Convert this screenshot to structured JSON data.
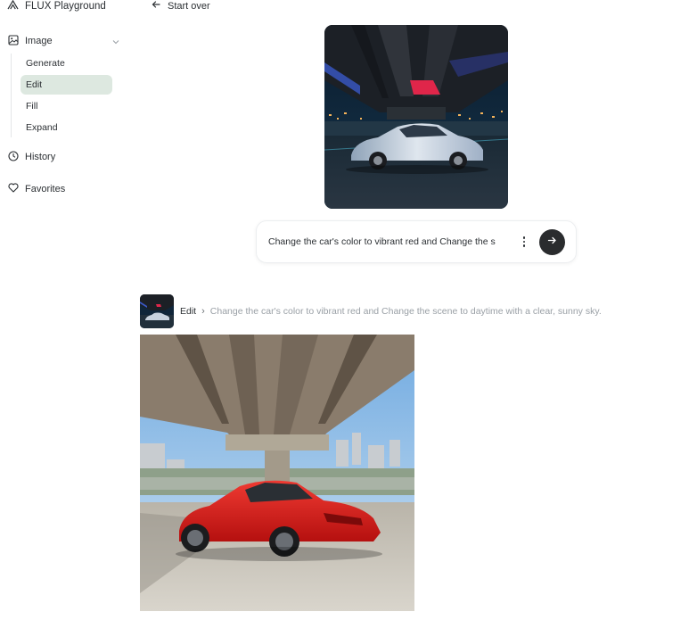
{
  "app": {
    "title": "FLUX Playground"
  },
  "sidebar": {
    "group_label": "Image",
    "subitems": [
      {
        "label": "Generate",
        "active": false
      },
      {
        "label": "Edit",
        "active": true
      },
      {
        "label": "Fill",
        "active": false
      },
      {
        "label": "Expand",
        "active": false
      }
    ],
    "history_label": "History",
    "favorites_label": "Favorites"
  },
  "header": {
    "start_over_label": "Start over"
  },
  "prompt": {
    "value": "Change the car's color to vibrant red and Change the s"
  },
  "result": {
    "mode_label": "Edit",
    "separator": "›",
    "prompt_full": "Change the car's color to vibrant red and Change the scene to daytime with a clear, sunny sky."
  },
  "colors": {
    "active_bg": "#dde8e0",
    "send_button": "#2a2c2e",
    "car_source": "#b9c2d0",
    "car_result": "#d81d1d"
  }
}
